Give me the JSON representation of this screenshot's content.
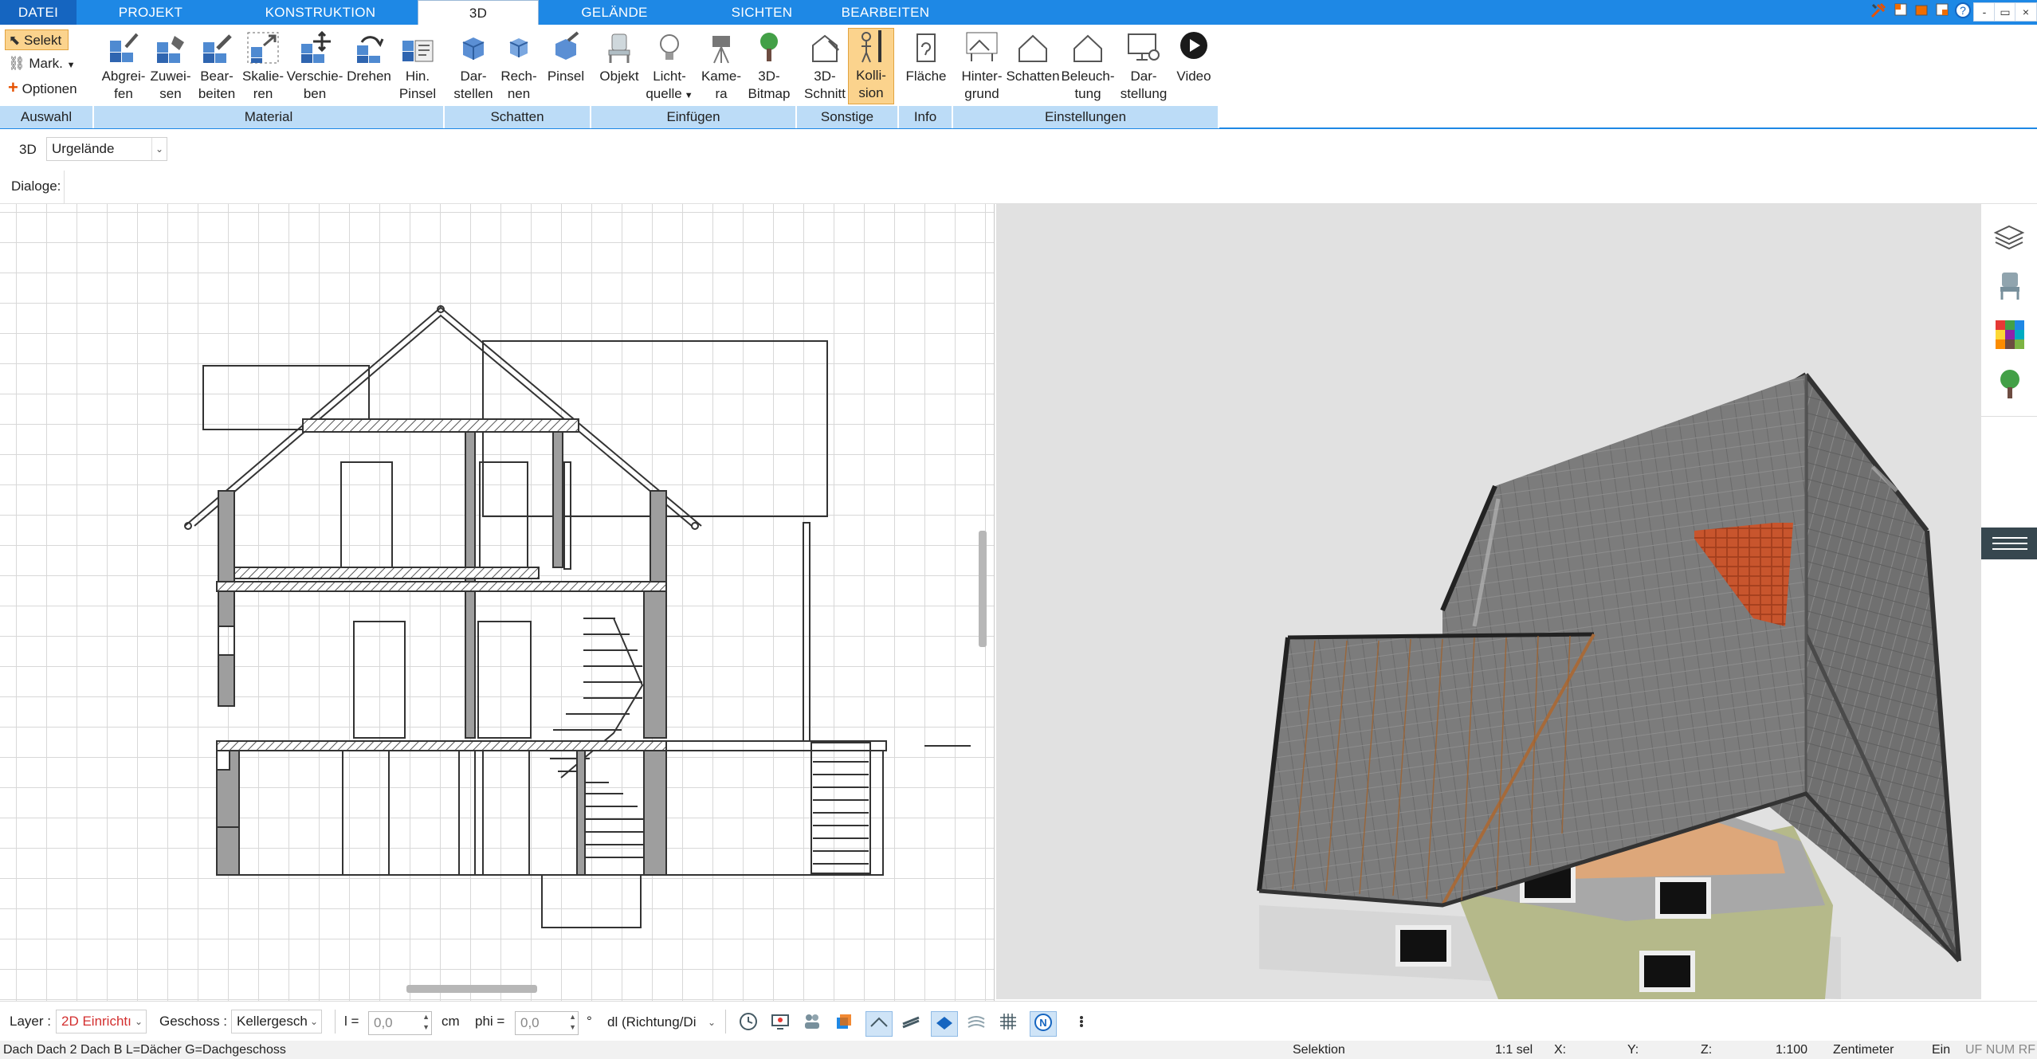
{
  "tabs": [
    {
      "label": "DATEI",
      "active": false
    },
    {
      "label": "PROJEKT",
      "active": false
    },
    {
      "label": "KONSTRUKTION",
      "active": false
    },
    {
      "label": "3D",
      "active": true
    },
    {
      "label": "GELÄNDE",
      "active": false
    },
    {
      "label": "SICHTEN",
      "active": false
    },
    {
      "label": "BEARBEITEN",
      "active": false
    }
  ],
  "window_controls": {
    "minimize": "-",
    "restore": "▭",
    "close": "×"
  },
  "auswahl": {
    "selekt": "Selekt",
    "mark": "Mark.",
    "optionen": "Optionen",
    "group": "Auswahl"
  },
  "groups": {
    "material": "Material",
    "schatten": "Schatten",
    "einfuegen": "Einfügen",
    "sonstige": "Sonstige",
    "info": "Info",
    "einstellungen": "Einstellungen"
  },
  "buttons": {
    "abgreifen": [
      "Abgrei-",
      "fen"
    ],
    "zuweisen": [
      "Zuwei-",
      "sen"
    ],
    "bearbeiten": [
      "Bear-",
      "beiten"
    ],
    "skalieren": [
      "Skalie-",
      "ren"
    ],
    "verschieben": [
      "Verschie-",
      "ben"
    ],
    "drehen": [
      "Drehen",
      ""
    ],
    "hinpinsel": [
      "Hin.",
      "Pinsel"
    ],
    "darstellen": [
      "Dar-",
      "stellen"
    ],
    "rechnen": [
      "Rech-",
      "nen"
    ],
    "pinsel": [
      "Pinsel",
      ""
    ],
    "objekt": [
      "Objekt",
      ""
    ],
    "lichtquelle": [
      "Licht-",
      "quelle"
    ],
    "kamera": [
      "Kame-",
      "ra"
    ],
    "bitmap3d": [
      "3D-",
      "Bitmap"
    ],
    "schnitt3d": [
      "3D-",
      "Schnitt"
    ],
    "kollision": [
      "Kolli-",
      "sion"
    ],
    "flaeche": [
      "Fläche",
      ""
    ],
    "hintergrund": [
      "Hinter-",
      "grund"
    ],
    "schatten": [
      "Schatten",
      ""
    ],
    "beleuchtung": [
      "Beleuch-",
      "tung"
    ],
    "darstellung": [
      "Dar-",
      "stellung"
    ],
    "video": [
      "Video",
      ""
    ]
  },
  "view_row": {
    "label": "3D",
    "value": "Urgelände"
  },
  "dialoge_label": "Dialoge:",
  "bottom": {
    "layer_label": "Layer :",
    "layer_value": "2D Einrichtı",
    "geschoss_label": "Geschoss :",
    "geschoss_value": "Kellergesch",
    "l_label": "l =",
    "l_value": "0,0",
    "cm_label": "cm",
    "phi_label": "phi =",
    "phi_value": "0,0",
    "deg_label": "°",
    "dl_value": "dl (Richtung/Di"
  },
  "status": {
    "left": "Dach Dach 2 Dach B L=Dächer G=Dachgeschoss",
    "mode": "Selektion",
    "sel": "1:1 sel",
    "x": "X:",
    "y": "Y:",
    "z": "Z:",
    "scale": "1:100",
    "unit": "Zentimeter",
    "ein": "Ein",
    "flags": "UF NUM RF"
  },
  "colors": {
    "accent": "#1e88e5",
    "group_bg": "#bcdcf7",
    "highlight": "#fbd38d",
    "roof_grey": "#7a7a7a",
    "roof_tile": "#c8552d",
    "wall_green": "#b5b98a"
  }
}
